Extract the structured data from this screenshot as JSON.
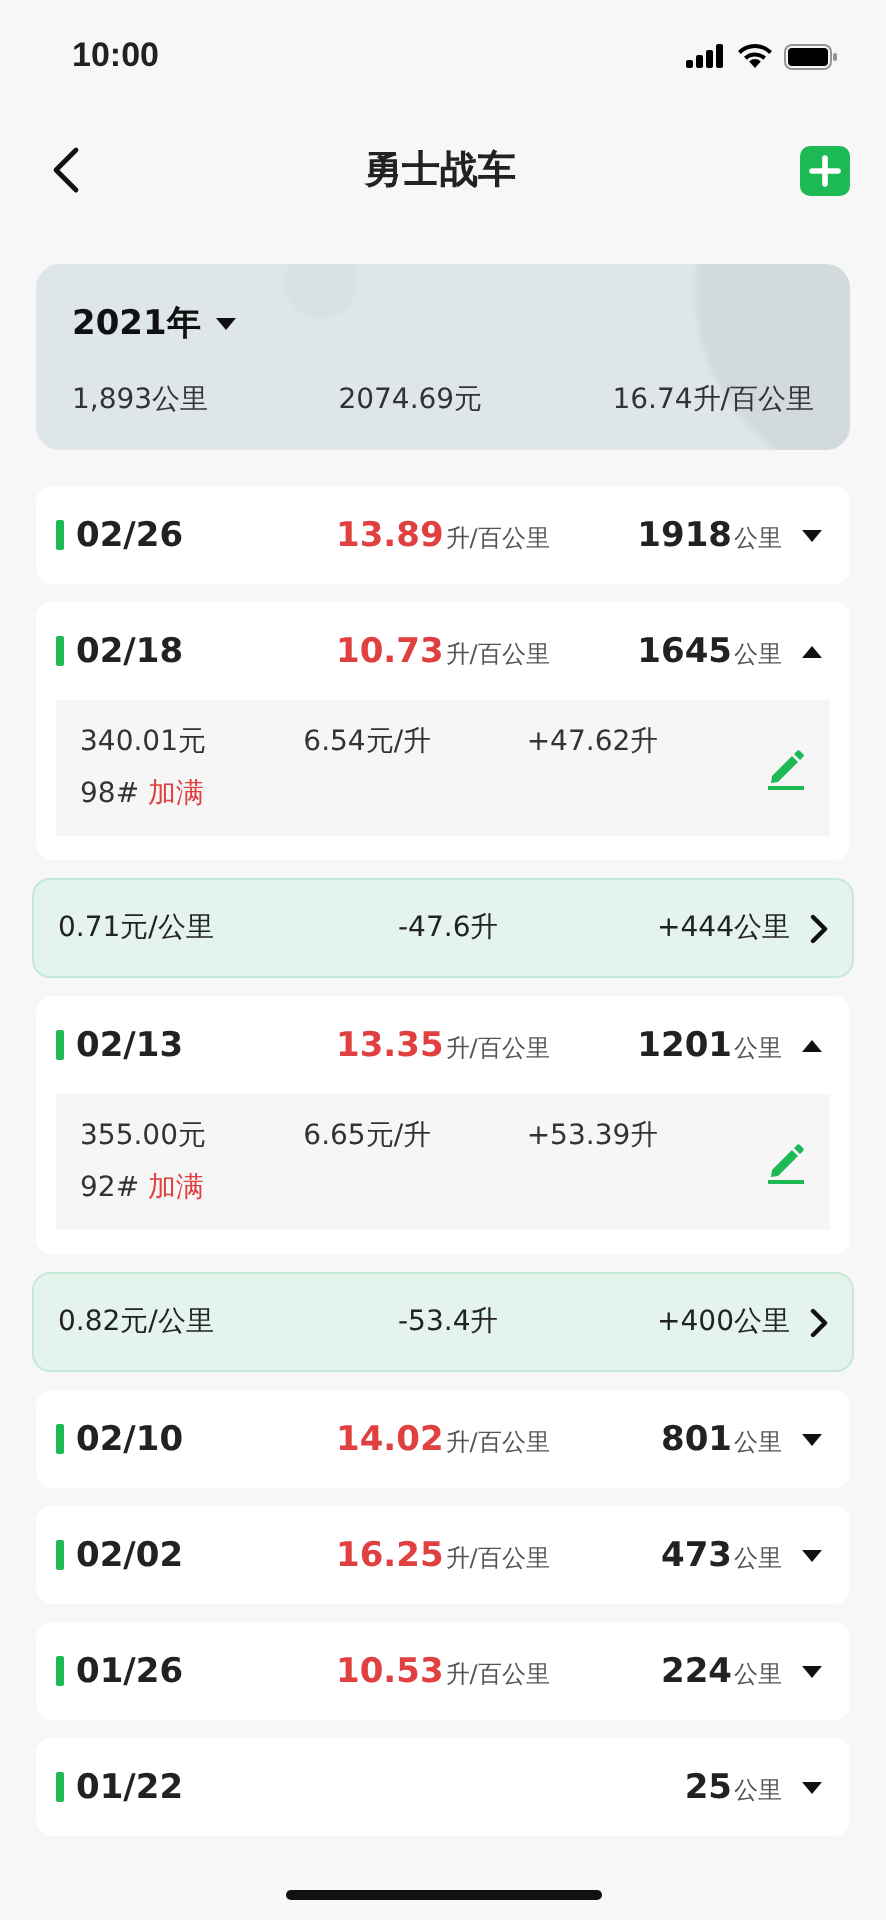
{
  "status_bar": {
    "time": "10:00"
  },
  "nav": {
    "title": "勇士战车"
  },
  "summary": {
    "year": "2021年",
    "distance": "1,893公里",
    "cost": "2074.69元",
    "consumption": "16.74升/百公里"
  },
  "list": [
    {
      "kind": "record",
      "date": "02/26",
      "consumption": "13.89",
      "consumption_unit": "升/百公里",
      "odometer": "1918",
      "odometer_unit": "公里",
      "expanded": false
    },
    {
      "kind": "record",
      "date": "02/18",
      "consumption": "10.73",
      "consumption_unit": "升/百公里",
      "odometer": "1645",
      "odometer_unit": "公里",
      "expanded": true,
      "details": {
        "cost": "340.01元",
        "price": "6.54元/升",
        "volume": "+47.62升",
        "grade": "98#",
        "tag": "加满"
      }
    },
    {
      "kind": "summary",
      "cost_per_km": "0.71元/公里",
      "fuel_change": "-47.6升",
      "distance": "+444公里"
    },
    {
      "kind": "record",
      "date": "02/13",
      "consumption": "13.35",
      "consumption_unit": "升/百公里",
      "odometer": "1201",
      "odometer_unit": "公里",
      "expanded": true,
      "details": {
        "cost": "355.00元",
        "price": "6.65元/升",
        "volume": "+53.39升",
        "grade": "92#",
        "tag": "加满"
      }
    },
    {
      "kind": "summary",
      "cost_per_km": "0.82元/公里",
      "fuel_change": "-53.4升",
      "distance": "+400公里"
    },
    {
      "kind": "record",
      "date": "02/10",
      "consumption": "14.02",
      "consumption_unit": "升/百公里",
      "odometer": "801",
      "odometer_unit": "公里",
      "expanded": false
    },
    {
      "kind": "record",
      "date": "02/02",
      "consumption": "16.25",
      "consumption_unit": "升/百公里",
      "odometer": "473",
      "odometer_unit": "公里",
      "expanded": false
    },
    {
      "kind": "record",
      "date": "01/26",
      "consumption": "10.53",
      "consumption_unit": "升/百公里",
      "odometer": "224",
      "odometer_unit": "公里",
      "expanded": false
    },
    {
      "kind": "record",
      "date": "01/22",
      "odometer": "25",
      "odometer_unit": "公里",
      "expanded": false
    }
  ]
}
